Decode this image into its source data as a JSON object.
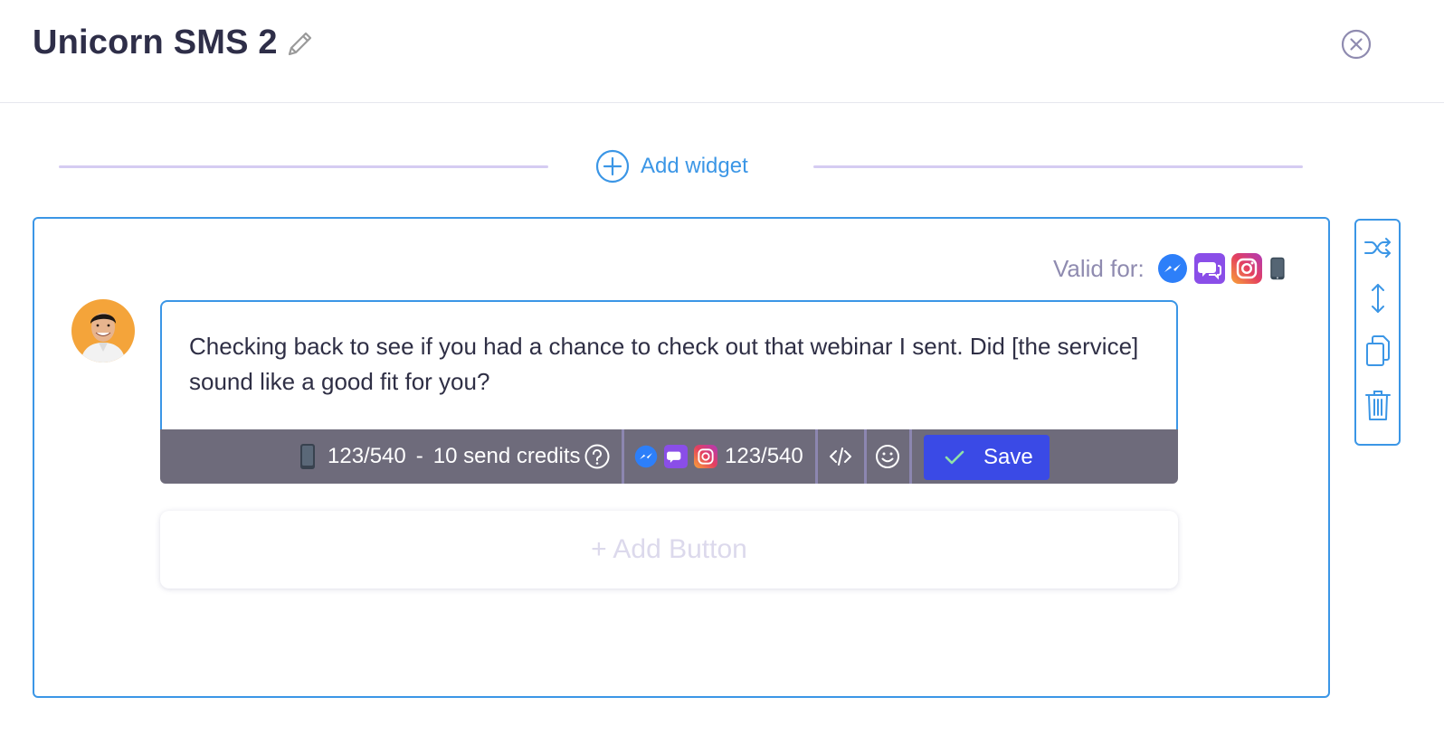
{
  "header": {
    "title": "Unicorn SMS 2"
  },
  "add_widget": {
    "label": "Add widget"
  },
  "valid_for": {
    "label": "Valid for:",
    "channels": [
      "messenger-icon",
      "chat-icon",
      "instagram-icon",
      "sms-phone-icon"
    ]
  },
  "message": {
    "text": "Checking back to see if you had a chance to check out that webinar I sent. Did [the service] sound like a good fit for you?"
  },
  "toolbar": {
    "sms_count": "123/540",
    "dash": "-",
    "send_credits": "10 send credits",
    "social_count": "123/540",
    "save_label": "Save"
  },
  "add_button": {
    "label": "+ Add Button"
  },
  "colors": {
    "accent": "#3b96e6",
    "save": "#3a4ae6",
    "toolbar": "#6e6b7b",
    "messenger": "#2d7ff9",
    "chat": "#8a4ee8",
    "instagram": "#e4405f"
  }
}
